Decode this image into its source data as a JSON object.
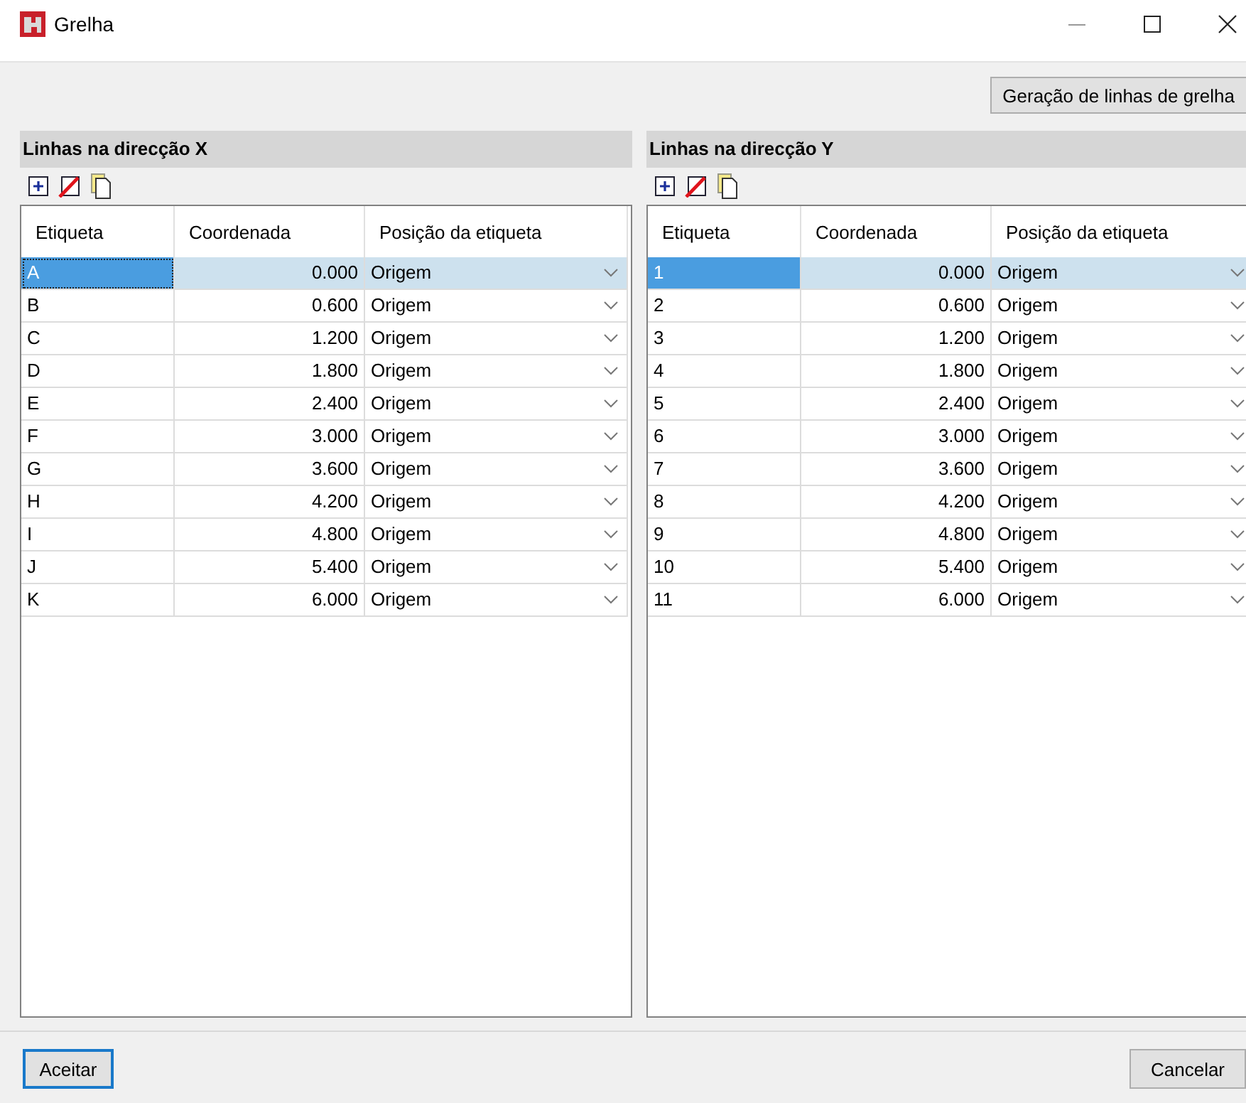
{
  "window": {
    "title": "Grelha"
  },
  "top_button": {
    "label": "Geração de linhas de grelha"
  },
  "tables": [
    {
      "title": "Linhas na direcção X",
      "focused": true,
      "columns": [
        "Etiqueta",
        "Coordenada",
        "Posição da etiqueta"
      ],
      "rows": [
        {
          "label": "A",
          "coordinate": "0.000",
          "position": "Origem",
          "selected": true
        },
        {
          "label": "B",
          "coordinate": "0.600",
          "position": "Origem",
          "selected": false
        },
        {
          "label": "C",
          "coordinate": "1.200",
          "position": "Origem",
          "selected": false
        },
        {
          "label": "D",
          "coordinate": "1.800",
          "position": "Origem",
          "selected": false
        },
        {
          "label": "E",
          "coordinate": "2.400",
          "position": "Origem",
          "selected": false
        },
        {
          "label": "F",
          "coordinate": "3.000",
          "position": "Origem",
          "selected": false
        },
        {
          "label": "G",
          "coordinate": "3.600",
          "position": "Origem",
          "selected": false
        },
        {
          "label": "H",
          "coordinate": "4.200",
          "position": "Origem",
          "selected": false
        },
        {
          "label": "I",
          "coordinate": "4.800",
          "position": "Origem",
          "selected": false
        },
        {
          "label": "J",
          "coordinate": "5.400",
          "position": "Origem",
          "selected": false
        },
        {
          "label": "K",
          "coordinate": "6.000",
          "position": "Origem",
          "selected": false
        }
      ]
    },
    {
      "title": "Linhas na direcção Y",
      "focused": false,
      "columns": [
        "Etiqueta",
        "Coordenada",
        "Posição da etiqueta"
      ],
      "rows": [
        {
          "label": "1",
          "coordinate": "0.000",
          "position": "Origem",
          "selected": true
        },
        {
          "label": "2",
          "coordinate": "0.600",
          "position": "Origem",
          "selected": false
        },
        {
          "label": "3",
          "coordinate": "1.200",
          "position": "Origem",
          "selected": false
        },
        {
          "label": "4",
          "coordinate": "1.800",
          "position": "Origem",
          "selected": false
        },
        {
          "label": "5",
          "coordinate": "2.400",
          "position": "Origem",
          "selected": false
        },
        {
          "label": "6",
          "coordinate": "3.000",
          "position": "Origem",
          "selected": false
        },
        {
          "label": "7",
          "coordinate": "3.600",
          "position": "Origem",
          "selected": false
        },
        {
          "label": "8",
          "coordinate": "4.200",
          "position": "Origem",
          "selected": false
        },
        {
          "label": "9",
          "coordinate": "4.800",
          "position": "Origem",
          "selected": false
        },
        {
          "label": "10",
          "coordinate": "5.400",
          "position": "Origem",
          "selected": false
        },
        {
          "label": "11",
          "coordinate": "6.000",
          "position": "Origem",
          "selected": false
        }
      ]
    }
  ],
  "buttons": [
    {
      "label": "Aceitar",
      "default": true
    },
    {
      "label": "Cancelar",
      "default": false
    }
  ]
}
